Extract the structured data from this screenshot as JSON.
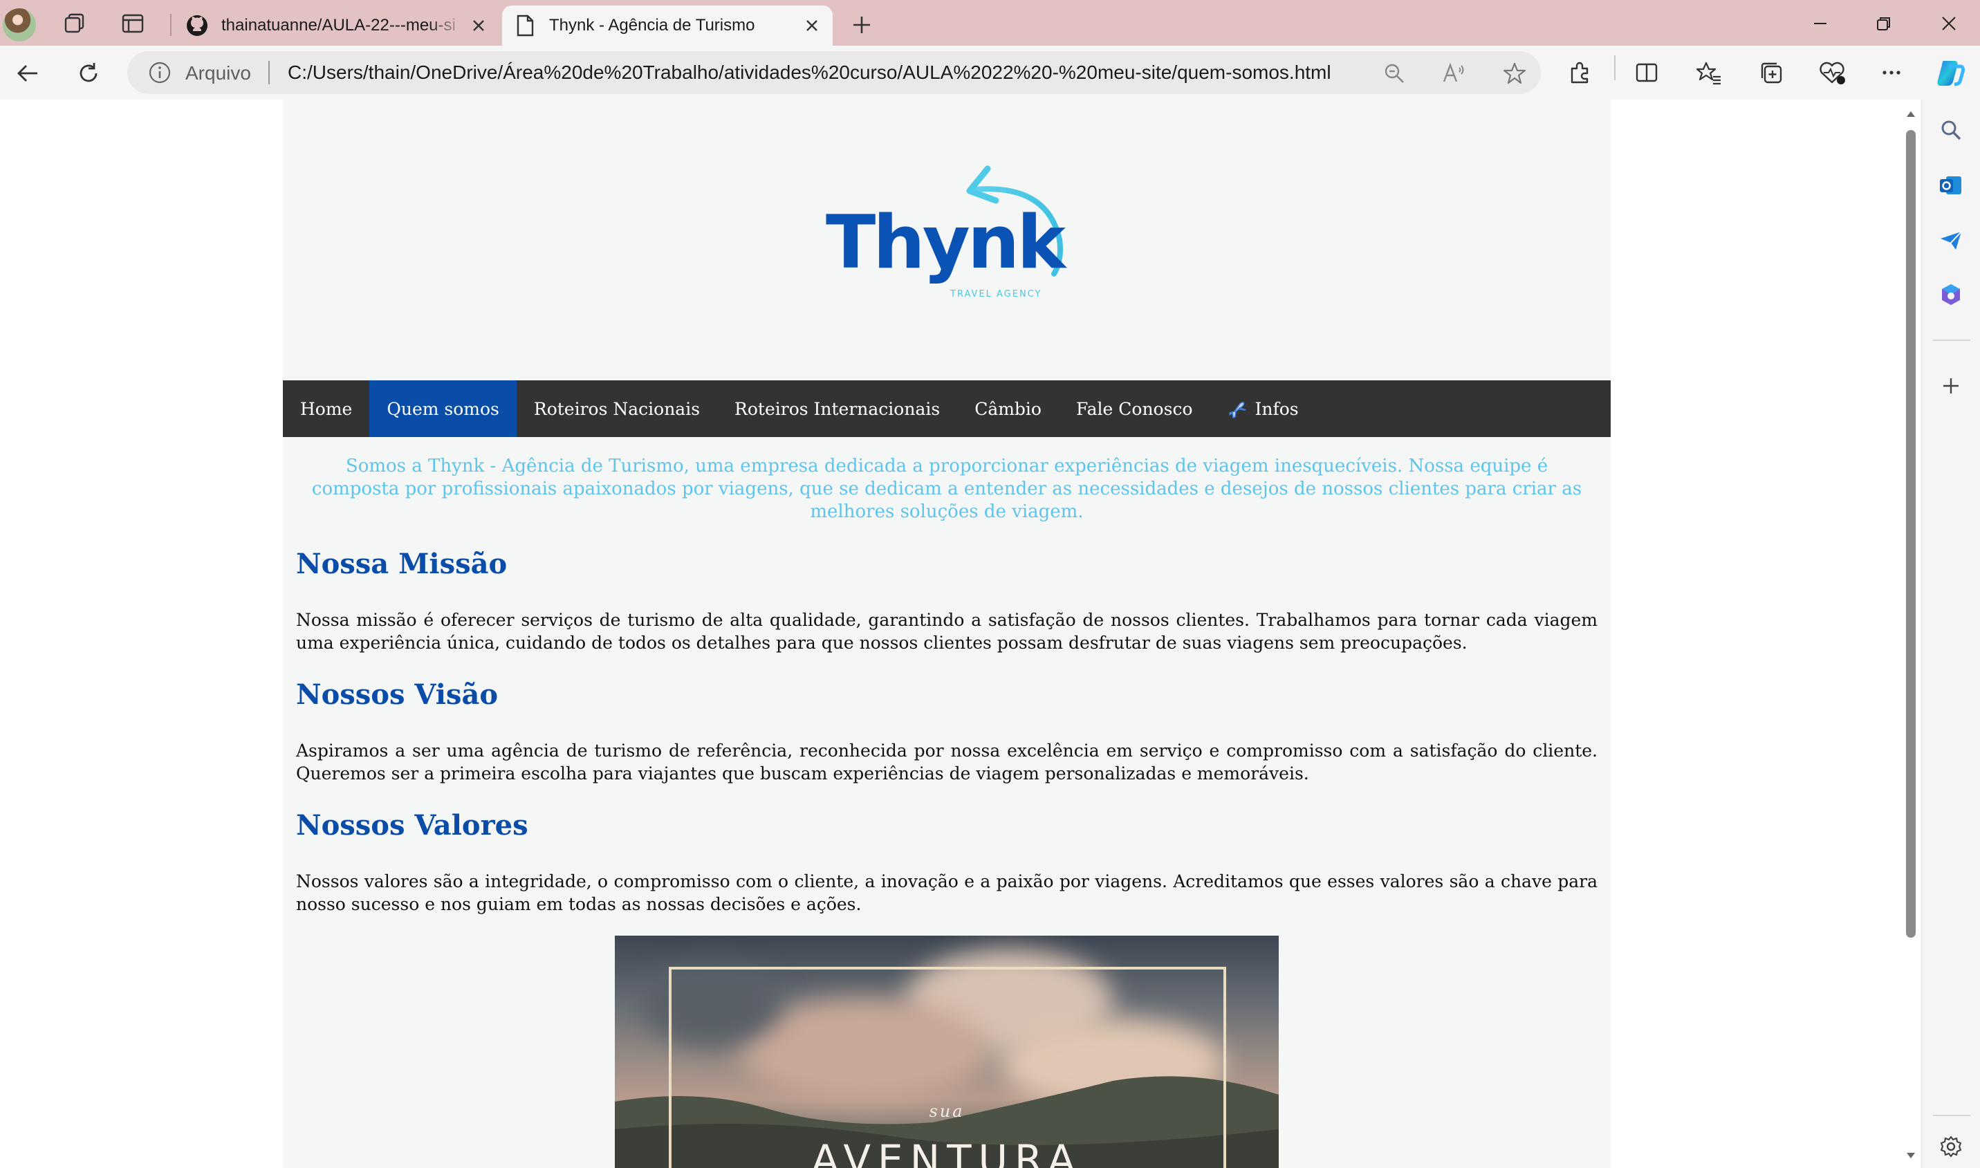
{
  "browser": {
    "tabs": [
      {
        "title": "thainatuanne/AULA-22---meu-si",
        "active": false,
        "favicon": "github-icon"
      },
      {
        "title": "Thynk - Agência de Turismo",
        "active": true,
        "favicon": "page-icon"
      }
    ],
    "address": {
      "scheme_label": "Arquivo",
      "url": "C:/Users/thain/OneDrive/Área%20de%20Trabalho/atividades%20curso/AULA%2022%20-%20meu-site/quem-somos.html"
    }
  },
  "site": {
    "logo": {
      "name": "Thynk",
      "tagline": "TRAVEL AGENCY"
    },
    "menu": [
      {
        "label": "Home",
        "active": false
      },
      {
        "label": "Quem somos",
        "active": true
      },
      {
        "label": "Roteiros Nacionais",
        "active": false
      },
      {
        "label": "Roteiros Internacionais",
        "active": false
      },
      {
        "label": "Câmbio",
        "active": false
      },
      {
        "label": "Fale Conosco",
        "active": false
      },
      {
        "label": "Infos",
        "active": false,
        "icon": "plane-icon"
      }
    ],
    "intro": "Somos a Thynk - Agência de Turismo, uma empresa dedicada a proporcionar experiências de viagem inesquecíveis. Nossa equipe é composta por profissionais apaixonados por viagens, que se dedicam a entender as necessidades e desejos de nossos clientes para criar as melhores soluções de viagem.",
    "sections": [
      {
        "title": "Nossa Missão",
        "text": "Nossa missão é oferecer serviços de turismo de alta qualidade, garantindo a satisfação de nossos clientes. Trabalhamos para tornar cada viagem uma experiência única, cuidando de todos os detalhes para que nossos clientes possam desfrutar de suas viagens sem preocupações."
      },
      {
        "title": "Nossos Visão",
        "text": "Aspiramos a ser uma agência de turismo de referência, reconhecida por nossa excelência em serviço e compromisso com a satisfação do cliente. Queremos ser a primeira escolha para viajantes que buscam experiências de viagem personalizadas e memoráveis."
      },
      {
        "title": "Nossos Valores",
        "text": "Nossos valores são a integridade, o compromisso com o cliente, a inovação e a paixão por viagens. Acreditamos que esses valores são a chave para nosso sucesso e nos guiam em todas as nossas decisões e ações."
      }
    ],
    "banner": {
      "small_text": "sua",
      "big_text": "AVENTURA"
    }
  },
  "colors": {
    "brand_blue": "#0a4da8",
    "intro_text": "#5ec4ec",
    "menu_bg": "#333333",
    "tab_strip": "#e2c2c3"
  }
}
